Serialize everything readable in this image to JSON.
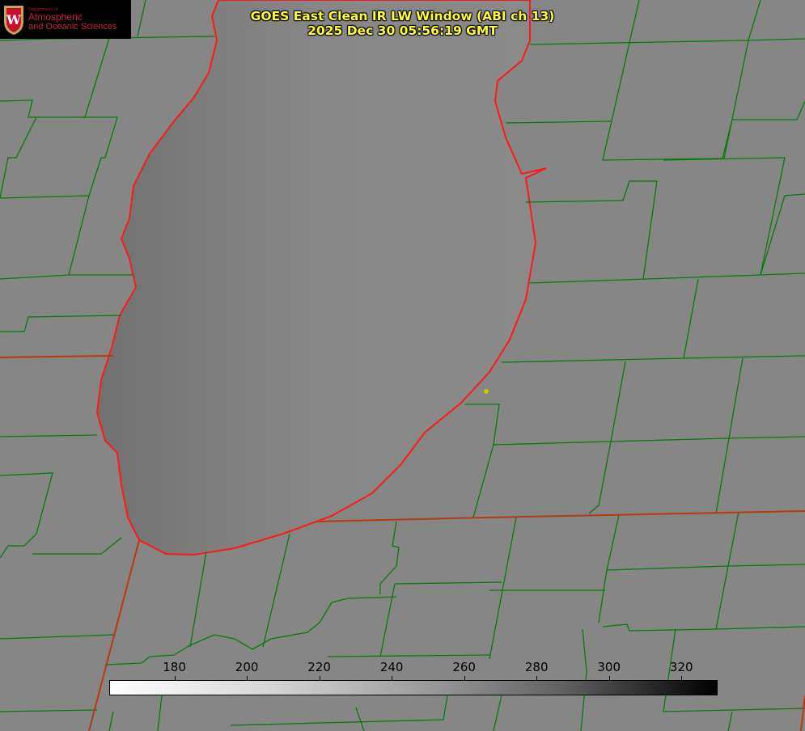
{
  "title": {
    "line1": "GOES East Clean IR LW Window (ABI ch 13)",
    "line2": "2025 Dec 30 05:56:19 GMT"
  },
  "logo": {
    "dept": "Department of",
    "name1": "Atmospheric",
    "name2": "and Oceanic Sciences",
    "seal_letter": "W"
  },
  "colorbar": {
    "min": 162,
    "max": 330,
    "ticks": [
      "180",
      "200",
      "220",
      "240",
      "260",
      "280",
      "300",
      "320"
    ],
    "tick_values": [
      180,
      200,
      220,
      240,
      260,
      280,
      300,
      320
    ]
  },
  "colors": {
    "county_lines": "#0a7a0a",
    "state_lines": "#cc2200",
    "coast": "#ff1a1a",
    "marker": "#d4c400",
    "title": "#ffff33"
  }
}
